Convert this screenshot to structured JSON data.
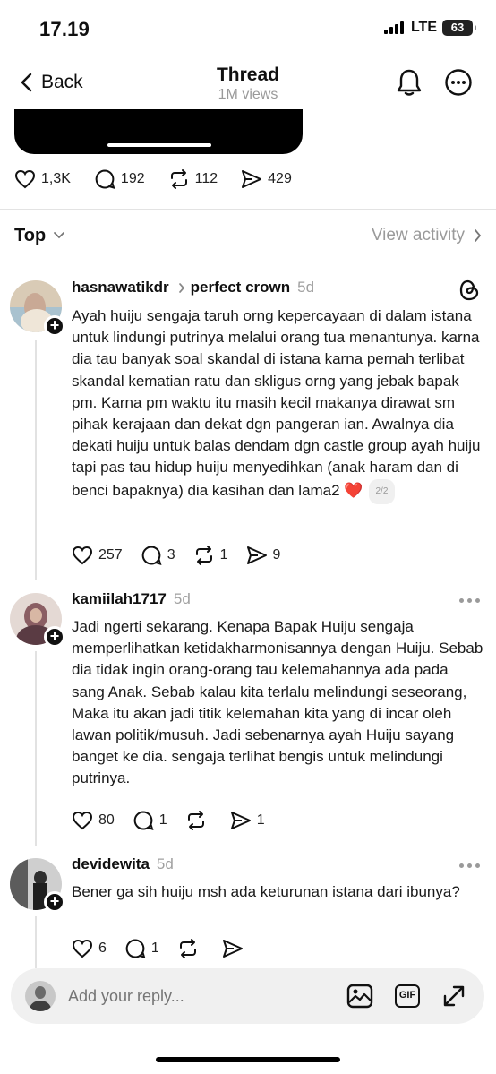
{
  "status_bar": {
    "time": "17.19",
    "network": "LTE",
    "battery": "63"
  },
  "nav": {
    "back_label": "Back",
    "title": "Thread",
    "views": "1M views",
    "icons": [
      "bell-icon",
      "more-circle-icon"
    ]
  },
  "post_actions": {
    "likes": "1,3K",
    "comments": "192",
    "reposts": "112",
    "shares": "429"
  },
  "sort": {
    "label": "Top",
    "view_activity": "View activity"
  },
  "comments": [
    {
      "username": "hasnawatikdr",
      "reply_to": "perfect crown",
      "time": "5d",
      "text": "Ayah huiju sengaja taruh orng kepercayaan di dalam istana untuk lindungi putrinya melalui orang tua menantunya. karna dia tau banyak soal skandal di istana karna pernah terlibat skandal kematian ratu dan skligus orng yang jebak bapak pm. Karna pm waktu itu masih kecil makanya dirawat sm pihak kerajaan dan dekat dgn pangeran ian. Awalnya dia dekati huiju untuk balas dendam dgn castle group ayah huiju tapi pas tau hidup huiju menyedihkan (anak haram dan di benci bapaknya) dia kasihan dan lama2",
      "emoji": "❤️",
      "page": "2/2",
      "likes": "257",
      "replies": "3",
      "reposts": "1",
      "shares": "9"
    },
    {
      "username": "kamiilah1717",
      "time": "5d",
      "text": "Jadi ngerti sekarang. Kenapa Bapak Huiju sengaja memperlihatkan ketidakharmonisannya dengan Huiju. Sebab dia tidak ingin orang-orang tau kelemahannya ada pada sang Anak. Sebab kalau kita terlalu melindungi seseorang, Maka itu akan jadi titik kelemahan kita yang di incar oleh lawan politik/musuh. Jadi sebenarnya ayah Huiju sayang banget ke dia. sengaja terlihat bengis untuk melindungi putrinya.",
      "likes": "80",
      "replies": "1",
      "reposts": "",
      "shares": "1"
    },
    {
      "username": "devidewita",
      "time": "5d",
      "text": "Bener ga sih huiju msh ada keturunan istana dari ibunya?",
      "likes": "6",
      "replies": "1",
      "reposts": "",
      "shares": ""
    }
  ],
  "reply_bar": {
    "placeholder": "Add your reply...",
    "gif_label": "GIF"
  }
}
